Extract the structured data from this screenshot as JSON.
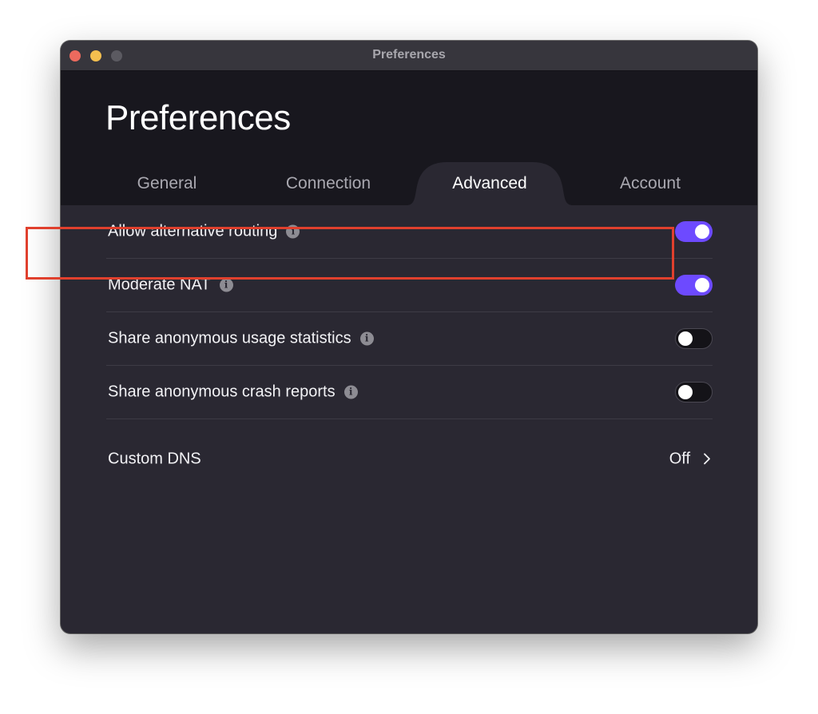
{
  "window": {
    "title": "Preferences"
  },
  "header": {
    "title": "Preferences"
  },
  "tabs": [
    {
      "label": "General",
      "active": false
    },
    {
      "label": "Connection",
      "active": false
    },
    {
      "label": "Advanced",
      "active": true
    },
    {
      "label": "Account",
      "active": false
    }
  ],
  "settings": [
    {
      "label": "Allow alternative routing",
      "info_icon": "info-icon",
      "toggle": "on"
    },
    {
      "label": "Moderate NAT",
      "info_icon": "info-icon",
      "toggle": "on"
    },
    {
      "label": "Share anonymous usage statistics",
      "info_icon": "info-icon",
      "toggle": "off"
    },
    {
      "label": "Share anonymous crash reports",
      "info_icon": "info-icon",
      "toggle": "off"
    }
  ],
  "custom_dns": {
    "label": "Custom DNS",
    "value": "Off",
    "chevron_icon": "chevron-right-icon"
  },
  "info_glyph": "i",
  "colors": {
    "accent": "#6d4aff",
    "highlight": "#e0402d",
    "header_bg": "#18171e",
    "content_bg": "#2a2832"
  }
}
